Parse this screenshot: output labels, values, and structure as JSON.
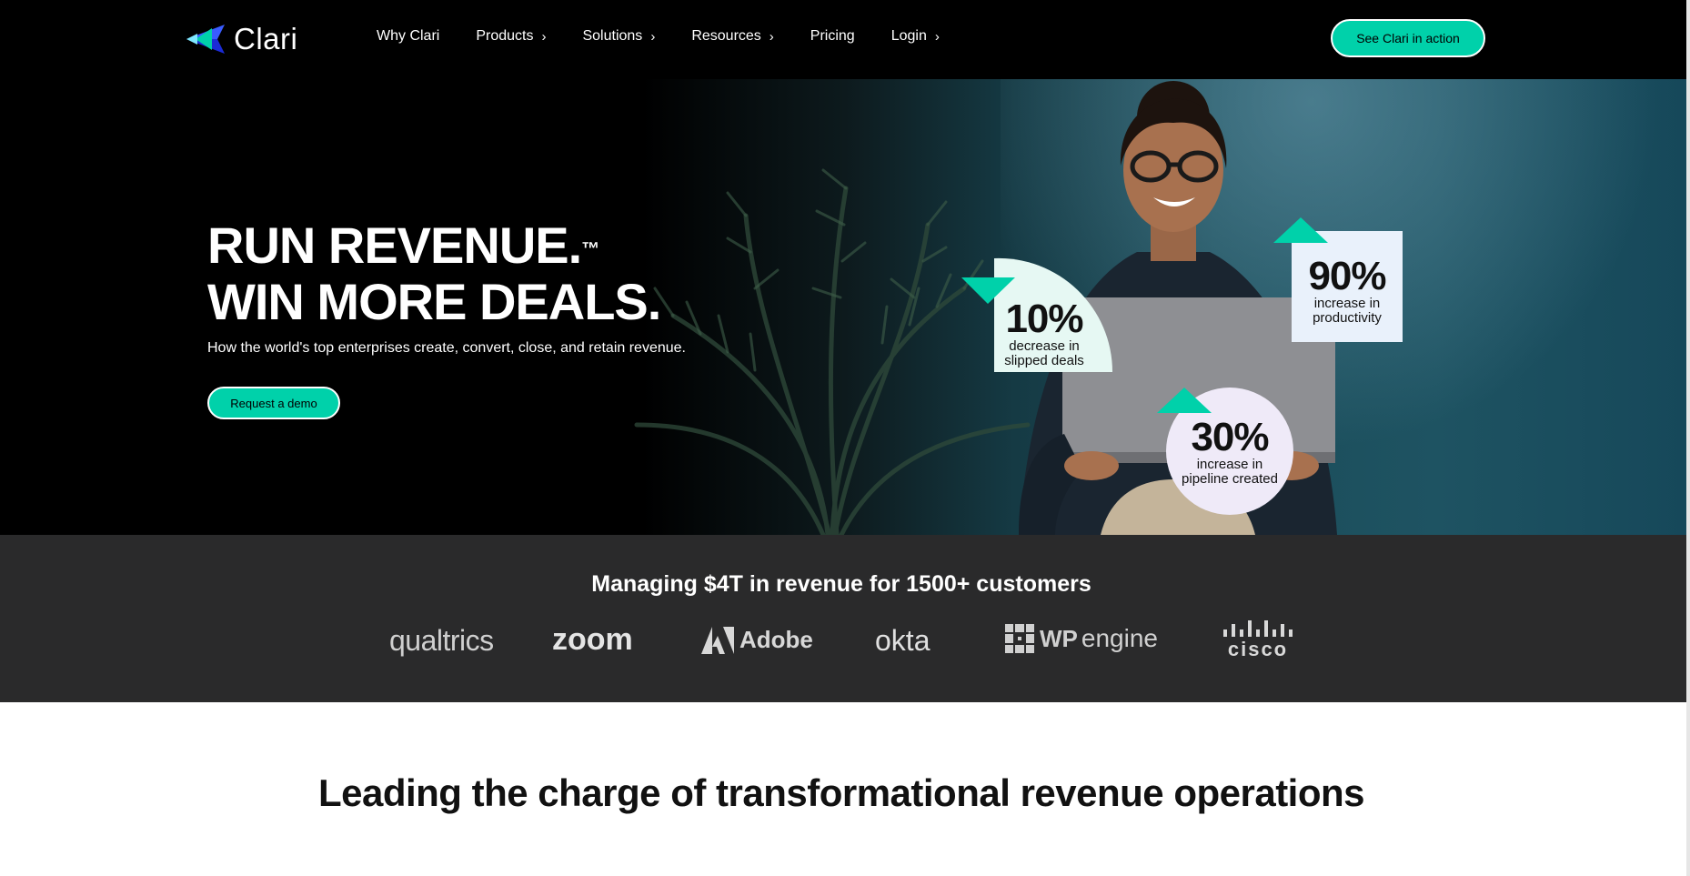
{
  "nav": {
    "brand": "Clari",
    "items": [
      {
        "label": "Why Clari",
        "has_chevron": false
      },
      {
        "label": "Products",
        "has_chevron": true
      },
      {
        "label": "Solutions",
        "has_chevron": true
      },
      {
        "label": "Resources",
        "has_chevron": true
      },
      {
        "label": "Pricing",
        "has_chevron": false
      },
      {
        "label": "Login",
        "has_chevron": true
      }
    ],
    "cta": "See Clari in action"
  },
  "hero": {
    "headline_line1": "RUN REVENUE.",
    "trademark": "™",
    "headline_line2": "WIN MORE DEALS.",
    "subhead": "How the world's top enterprises create, convert, close, and retain revenue.",
    "cta": "Request a demo",
    "stats": [
      {
        "value": "10%",
        "line1": "decrease in",
        "line2": "slipped deals"
      },
      {
        "value": "90%",
        "line1": "increase in",
        "line2": "productivity"
      },
      {
        "value": "30%",
        "line1": "increase in",
        "line2": "pipeline created"
      }
    ]
  },
  "customers": {
    "title": "Managing $4T in revenue for 1500+ customers",
    "logos": [
      "qualtrics",
      "zoom",
      "Adobe",
      "okta",
      "WP",
      "engine",
      "cisco"
    ]
  },
  "section": {
    "title": "Leading the charge of transformational revenue operations"
  },
  "colors": {
    "accent": "#00d1aa",
    "nav_bg": "#000000",
    "logo_bar_bg": "#2a2a2b",
    "stat_card_mint": "#e6f8f3",
    "stat_card_blue": "#e9f1fb",
    "stat_card_lavender": "#efeaf8"
  }
}
